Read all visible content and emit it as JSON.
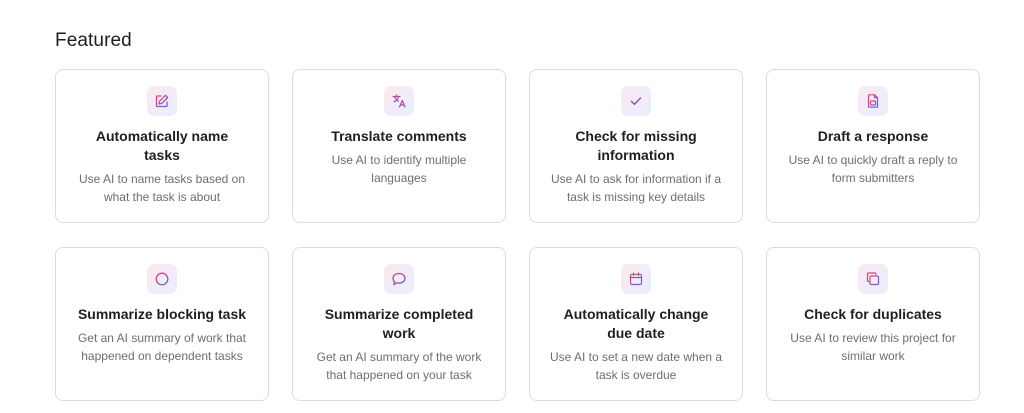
{
  "section": {
    "title": "Featured"
  },
  "colors": {
    "icon_stroke_start": "#e8436a",
    "icon_stroke_end": "#5b63e6",
    "card_border": "#dcdcdc"
  },
  "cards": [
    {
      "icon": "edit-icon",
      "title": "Automatically name tasks",
      "description": "Use AI to name tasks based on what the task is about"
    },
    {
      "icon": "translate-icon",
      "title": "Translate comments",
      "description": "Use AI to identify multiple languages"
    },
    {
      "icon": "check-icon",
      "title": "Check for missing information",
      "description": "Use AI to ask for information if a task is missing key details"
    },
    {
      "icon": "form-icon",
      "title": "Draft a response",
      "description": "Use AI to quickly draft a reply to form submitters"
    },
    {
      "icon": "blocked-icon",
      "title": "Summarize blocking task",
      "description": "Get an AI summary of work that happened on dependent tasks"
    },
    {
      "icon": "comment-icon",
      "title": "Summarize completed work",
      "description": "Get an AI summary of the work that happened on your task"
    },
    {
      "icon": "calendar-icon",
      "title": "Automatically change due date",
      "description": "Use AI to set a new date when a task is overdue"
    },
    {
      "icon": "duplicate-icon",
      "title": "Check for duplicates",
      "description": "Use AI to review this project for similar work"
    }
  ]
}
